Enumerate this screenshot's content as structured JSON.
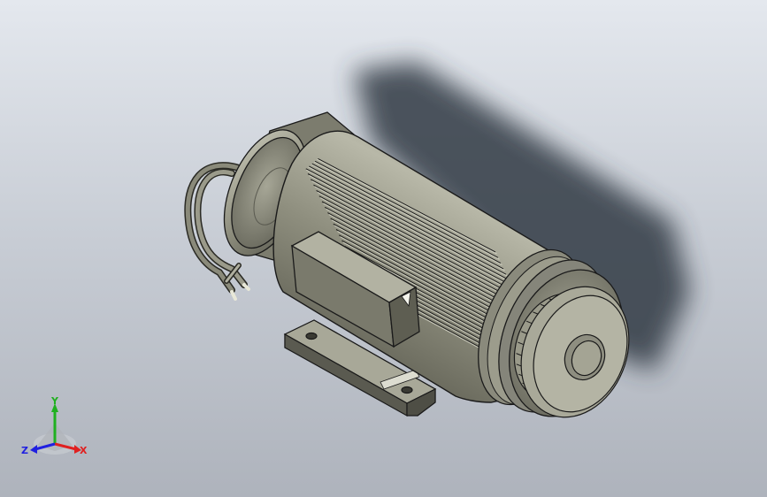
{
  "viewport": {
    "background_top": "#e4e8ee",
    "background_bottom": "#aeb3bc",
    "model_color": "#8e8e7e",
    "edge_color": "#1a1a1a"
  },
  "triad": {
    "x_label": "X",
    "y_label": "Y",
    "z_label": "Z",
    "x_color": "#e02020",
    "y_color": "#20b020",
    "z_color": "#2020e0"
  }
}
